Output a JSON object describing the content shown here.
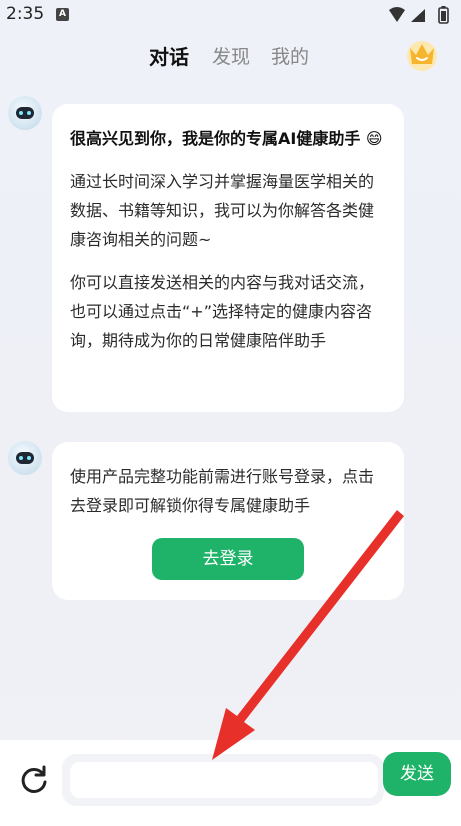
{
  "status": {
    "time": "2:35",
    "notif_letter": "A"
  },
  "header": {
    "tabs": [
      {
        "label": "对话"
      },
      {
        "label": "发现"
      },
      {
        "label": "我的"
      }
    ]
  },
  "messages": [
    {
      "title": "很高兴见到你，我是你的专属AI健康助手 😄",
      "para1": "通过长时间深入学习并掌握海量医学相关的数据、书籍等知识，我可以为你解答各类健康咨询相关的问题~",
      "para2": "你可以直接发送相关的内容与我对话交流，也可以通过点击“+”选择特定的健康内容咨询，期待成为你的日常健康陪伴助手"
    },
    {
      "text": "使用产品完整功能前需进行账号登录，点击去登录即可解锁你得专属健康助手",
      "button": "去登录"
    }
  ],
  "input": {
    "value": "",
    "send_label": "发送"
  },
  "colors": {
    "accent": "#1fb36a",
    "annotation_arrow": "#e8302a"
  }
}
